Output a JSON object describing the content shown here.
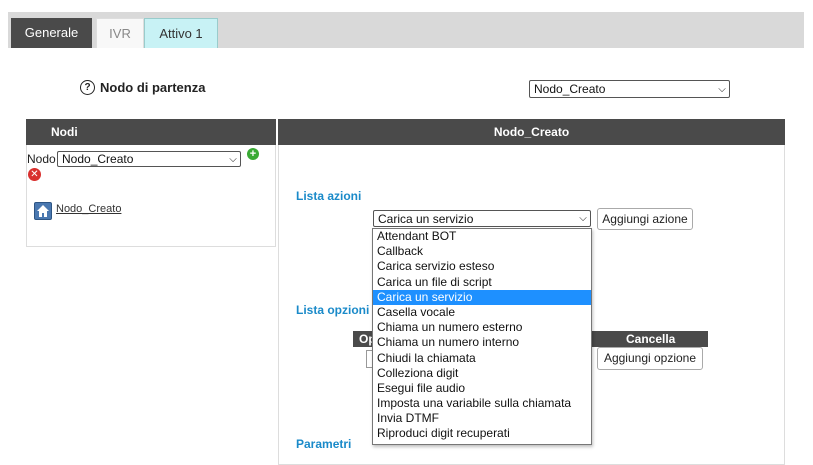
{
  "tabs": [
    {
      "label": "Generale"
    },
    {
      "label": "IVR"
    },
    {
      "label": "Attivo 1"
    }
  ],
  "start_node": {
    "label": "Nodo di partenza",
    "selected": "Nodo_Creato"
  },
  "nodes_panel": {
    "header": "Nodi",
    "nodo_label": "Nodo",
    "selected_node": "Nodo_Creato",
    "node_link": "Nodo_Creato"
  },
  "detail_panel": {
    "header": "Nodo_Creato",
    "lista_azioni_title": "Lista azioni",
    "action_selected": "Carica un servizio",
    "add_action_label": "Aggiungi azione",
    "lista_opzioni_title": "Lista opzioni",
    "options_table_header_first": "Op",
    "options_table_header_cancella": "Cancella",
    "add_option_label": "Aggiungi opzione",
    "parametri_title": "Parametri"
  },
  "action_options": [
    "Attendant BOT",
    "Callback",
    "Carica servizio esteso",
    "Carica un file di script",
    "Carica un servizio",
    "Casella vocale",
    "Chiama un numero esterno",
    "Chiama un numero interno",
    "Chiudi la chiamata",
    "Colleziona digit",
    "Esegui file audio",
    "Imposta una variabile sulla chiamata",
    "Invia DTMF",
    "Riproduci digit recuperati"
  ],
  "action_options_selected_index": 4,
  "colors": {
    "header_bg": "#4a4a4a",
    "accent": "#1a8ac9",
    "active_tab_bg": "#c8f2f5",
    "selected_option_bg": "#1e90ff"
  }
}
